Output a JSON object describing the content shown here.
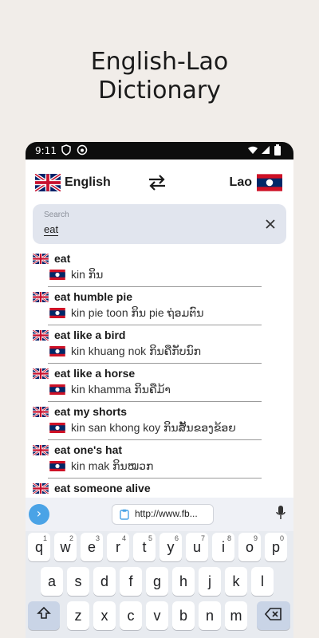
{
  "headline": [
    "English-Lao",
    "Dictionary"
  ],
  "status": {
    "time": "9:11"
  },
  "langs": {
    "source": "English",
    "target": "Lao"
  },
  "search": {
    "placeholder": "Search",
    "value": "eat"
  },
  "entries": [
    {
      "en": "eat",
      "lo": "kin  ກິນ"
    },
    {
      "en": "eat humble pie",
      "lo": "kin pie toon  ກິນ pie ຖ່ອມຕົນ"
    },
    {
      "en": "eat like a bird",
      "lo": "kin khuang nok  ກິນຄືກັບນົກ"
    },
    {
      "en": "eat like a horse",
      "lo": "kin khamma  ກິນຄືມ້າ"
    },
    {
      "en": "eat my shorts",
      "lo": "kin san khong koy  ກິນສັ້ນຂອງຂ້ອຍ"
    },
    {
      "en": "eat one's hat",
      "lo": "kin mak  ກິນໝວກ"
    },
    {
      "en": "eat someone alive",
      "lo": ""
    }
  ],
  "keyboard_bar": {
    "url": "http://www.fb..."
  },
  "keys": {
    "row1": [
      "q",
      "w",
      "e",
      "r",
      "t",
      "y",
      "u",
      "i",
      "o",
      "p"
    ],
    "row1_hints": [
      "1",
      "2",
      "3",
      "4",
      "5",
      "6",
      "7",
      "8",
      "9",
      "0"
    ],
    "row2": [
      "a",
      "s",
      "d",
      "f",
      "g",
      "h",
      "j",
      "k",
      "l"
    ],
    "row3": [
      "z",
      "x",
      "c",
      "v",
      "b",
      "n",
      "m"
    ]
  },
  "colors": {
    "uk_blue": "#012169",
    "uk_red": "#C8102E",
    "lao_red": "#CE1126",
    "lao_blue": "#002868"
  }
}
